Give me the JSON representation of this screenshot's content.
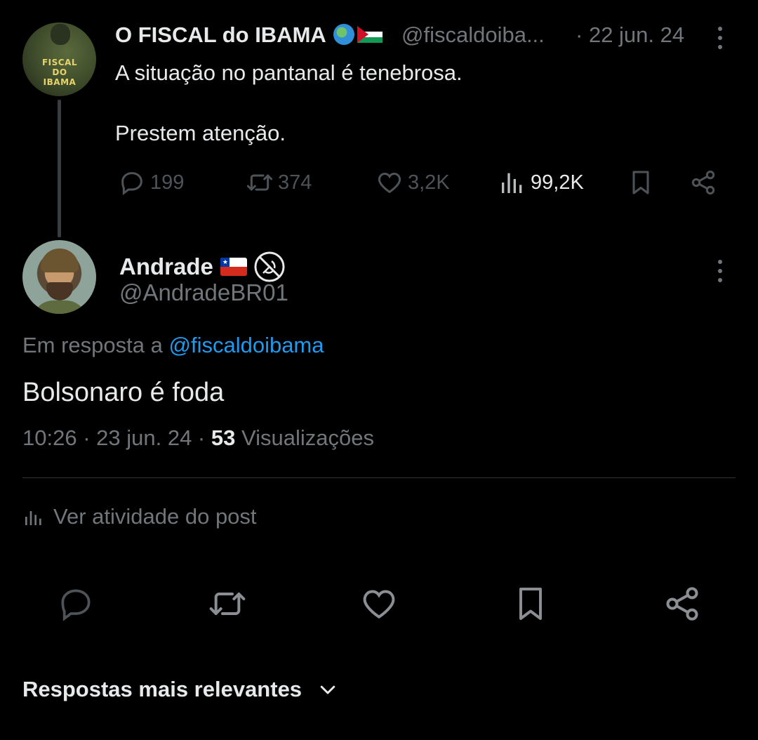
{
  "parent_tweet": {
    "author_name": "O FISCAL do IBAMA",
    "handle": "@fiscaldoiba...",
    "date_prefix": "·",
    "date": "22 jun. 24",
    "avatar_text": "FISCAL DO IBAMA",
    "text_line1": "A situação no pantanal é tenebrosa.",
    "text_line2": "Prestem atenção.",
    "counts": {
      "replies": "199",
      "reposts": "374",
      "likes": "3,2K",
      "views": "99,2K"
    }
  },
  "reply_tweet": {
    "author_name": "Andrade",
    "handle": "@AndradeBR01",
    "in_reply_prefix": "Em resposta a ",
    "in_reply_handle": "@fiscaldoibama",
    "text": "Bolsonaro é foda",
    "time": "10:26",
    "sep1": " · ",
    "date": "23 jun. 24",
    "sep2": " · ",
    "views_count": "53",
    "views_label": " Visualizações"
  },
  "post_activity_label": "Ver atividade do post",
  "sort_label": "Respostas mais relevantes",
  "colors": {
    "background": "#000000",
    "text": "#e7e9ea",
    "muted": "#71767b",
    "link": "#1d9bf0",
    "divider": "#2f3336"
  },
  "icons": [
    "reply-icon",
    "repost-icon",
    "like-icon",
    "views-icon",
    "bookmark-icon",
    "share-icon",
    "more-icon",
    "chevron-down-icon",
    "globe-icon",
    "palestine-flag-icon",
    "chile-flag-icon",
    "no-communism-icon"
  ]
}
